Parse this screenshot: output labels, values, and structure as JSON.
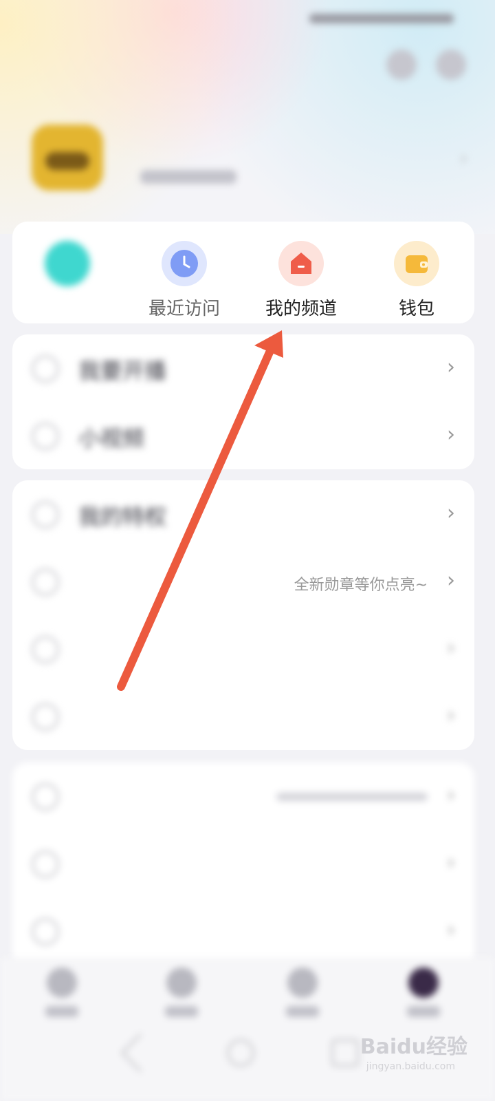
{
  "status_bar": {
    "left_text": "",
    "right_text": ""
  },
  "profile": {
    "username": "",
    "user_id": ""
  },
  "quick_actions": [
    {
      "label": "",
      "icon": "teal-circle-icon",
      "color": "#3fd7cf"
    },
    {
      "label": "最近访问",
      "icon": "clock-icon",
      "color": "#7f9cf5"
    },
    {
      "label": "我的频道",
      "icon": "channel-house-icon",
      "color": "#ef5d4a"
    },
    {
      "label": "钱包",
      "icon": "wallet-icon",
      "color": "#f5b93a"
    }
  ],
  "menu_group_1": [
    {
      "label": "我要开播",
      "right": ""
    },
    {
      "label": "小视频",
      "right": ""
    }
  ],
  "menu_group_2": [
    {
      "label": "我的特权",
      "right": ""
    },
    {
      "label": "",
      "right": "全新勋章等你点亮~"
    },
    {
      "label": "",
      "right": ""
    },
    {
      "label": "",
      "right": ""
    }
  ],
  "menu_group_3": [
    {
      "label": "",
      "right": ""
    },
    {
      "label": "",
      "right": ""
    },
    {
      "label": "",
      "right": ""
    }
  ],
  "tabs": [
    "",
    "",
    "",
    ""
  ],
  "watermark": {
    "brand": "Baidu经验",
    "url": "jingyan.baidu.com"
  },
  "annotation_arrow_color": "#ec5a3e"
}
